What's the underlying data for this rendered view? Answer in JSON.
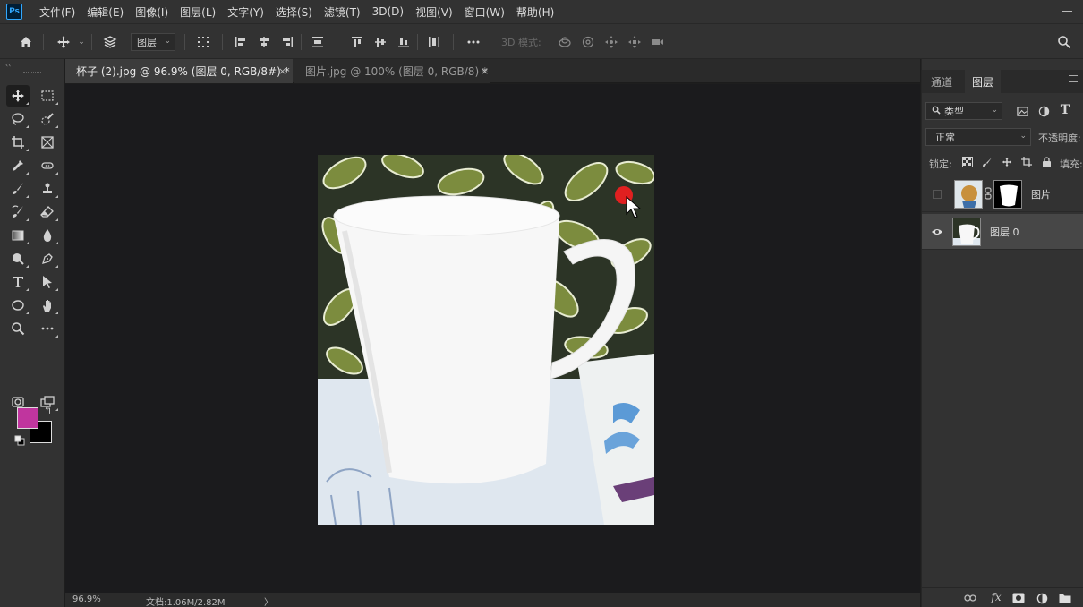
{
  "app": {
    "logo": "Ps"
  },
  "menu": [
    "文件(F)",
    "编辑(E)",
    "图像(I)",
    "图层(L)",
    "文字(Y)",
    "选择(S)",
    "滤镜(T)",
    "3D(D)",
    "视图(V)",
    "窗口(W)",
    "帮助(H)"
  ],
  "options_bar": {
    "auto_select_target": "图层",
    "mode_3d_label": "3D 模式:",
    "icons": [
      "home-icon",
      "move-tool-icon",
      "auto-select-icon",
      "transform-controls-icon",
      "align-left-icon",
      "align-hcenter-icon",
      "align-right-icon",
      "distribute-icon",
      "align-top-icon",
      "align-vcenter-icon",
      "align-bottom-icon",
      "distribute-vertical-icon",
      "more-icon",
      "orbit-3d-icon",
      "roll-3d-icon",
      "pan-3d-icon",
      "slide-3d-icon",
      "video-3d-icon",
      "search-icon"
    ]
  },
  "tabs": [
    {
      "label": "杯子 (2).jpg @ 96.9% (图层 0, RGB/8#) *",
      "active": true
    },
    {
      "label": "图片.jpg @ 100% (图层 0, RGB/8) *",
      "active": false
    }
  ],
  "toolbar": {
    "tools": [
      "move-tool-icon",
      "marquee-tool-icon",
      "lasso-tool-icon",
      "quick-select-tool-icon",
      "crop-tool-icon",
      "frame-tool-icon",
      "eyedropper-tool-icon",
      "spot-healing-tool-icon",
      "brush-tool-icon",
      "stamp-tool-icon",
      "history-brush-tool-icon",
      "eraser-tool-icon",
      "gradient-tool-icon",
      "blur-tool-icon",
      "dodge-tool-icon",
      "pen-tool-icon",
      "type-tool-icon",
      "path-select-tool-icon",
      "ellipse-tool-icon",
      "hand-tool-icon",
      "zoom-tool-icon",
      "more-tools-icon",
      "quick-mask-icon",
      "screen-mode-icon"
    ],
    "foreground_color": "#c0359e",
    "background_color": "#000000"
  },
  "status": {
    "zoom": "96.9%",
    "doc_info": "文档:1.06M/2.82M",
    "arrow": "〉"
  },
  "panel": {
    "tabs": [
      {
        "label": "通道",
        "active": false
      },
      {
        "label": "图层",
        "active": true
      }
    ],
    "filter_kind": "类型",
    "blend_mode": "正常",
    "opacity_label": "不透明度:",
    "lock_label": "锁定:",
    "fill_label": "填充:",
    "layers": [
      {
        "name": "图片",
        "visible": false,
        "has_mask": true
      },
      {
        "name": "图层 0",
        "visible": true,
        "selected": true
      }
    ]
  }
}
